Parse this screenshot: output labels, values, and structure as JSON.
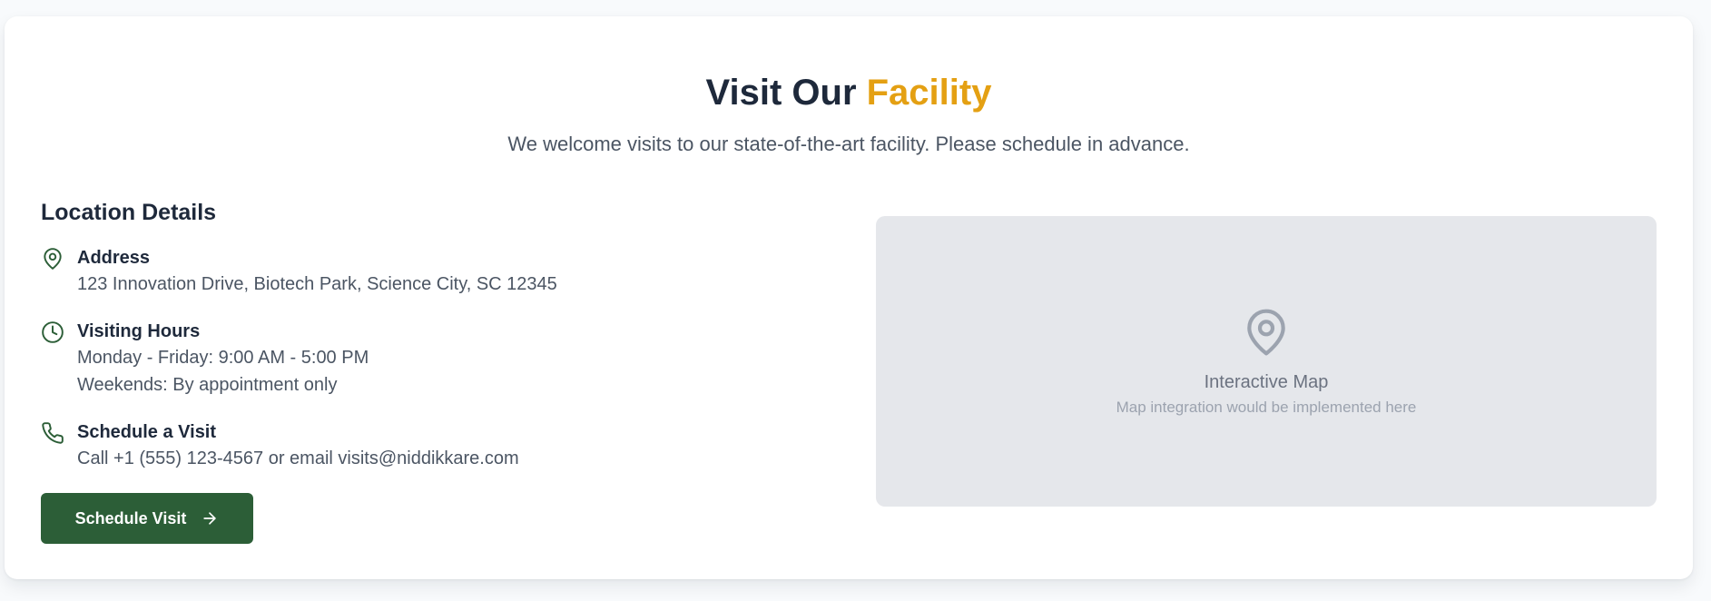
{
  "header": {
    "title_main": "Visit Our ",
    "title_accent": "Facility",
    "subtitle": "We welcome visits to our state-of-the-art facility. Please schedule in advance."
  },
  "location": {
    "section_title": "Location Details",
    "address": {
      "icon": "map-pin-icon",
      "label": "Address",
      "text": "123 Innovation Drive, Biotech Park, Science City, SC 12345"
    },
    "hours": {
      "icon": "clock-icon",
      "label": "Visiting Hours",
      "weekdays": "Monday - Friday: 9:00 AM - 5:00 PM",
      "weekends": "Weekends: By appointment only"
    },
    "schedule": {
      "icon": "phone-icon",
      "label": "Schedule a Visit",
      "text": "Call +1 (555) 123-4567 or email visits@niddikkare.com"
    }
  },
  "cta": {
    "label": "Schedule Visit",
    "icon": "arrow-right-icon"
  },
  "map": {
    "icon": "map-pin-icon",
    "title": "Interactive Map",
    "subtitle": "Map integration would be implemented here"
  },
  "colors": {
    "accent": "#e4a013",
    "primary": "#2c5e37",
    "heading": "#1e293b",
    "body_text": "#4b5563",
    "map_bg": "#e5e7eb"
  }
}
